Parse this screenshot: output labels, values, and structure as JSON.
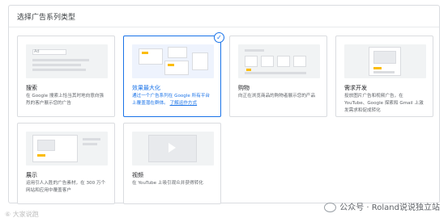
{
  "panel": {
    "title": "选择广告系列类型"
  },
  "cards": [
    {
      "title": "搜索",
      "desc": "在 Google 搜索上恰当其时地向意向强烈的客户展示您的广告",
      "thumb_label": "Ad"
    },
    {
      "title": "效果最大化",
      "desc": "通过一个广告系列在 Google 所有平台上覆盖潜在群体。",
      "link": "了解运作方式",
      "selected_mark": "✓"
    },
    {
      "title": "购物",
      "desc": "向正在浏览商品的购物者展示您的产品"
    },
    {
      "title": "需求开发",
      "desc": "投放图片广告和视频广告，在 YouTube、Google 探索和 Gmail 上激发需求和促成转化"
    },
    {
      "title": "展示",
      "desc": "运用引人入胜的广告素材，在 300 万个网站和应用中覆盖客户"
    },
    {
      "title": "视频",
      "desc": "在 YouTube 上吸引观众并获得转化"
    }
  ],
  "watermark": {
    "left": "⑥ 大家说跑",
    "right": "公众号 · Roland说说独立站"
  },
  "colors": {
    "accent": "#1a73e8",
    "yellow": "#fbbc04",
    "border": "#dadce0"
  }
}
